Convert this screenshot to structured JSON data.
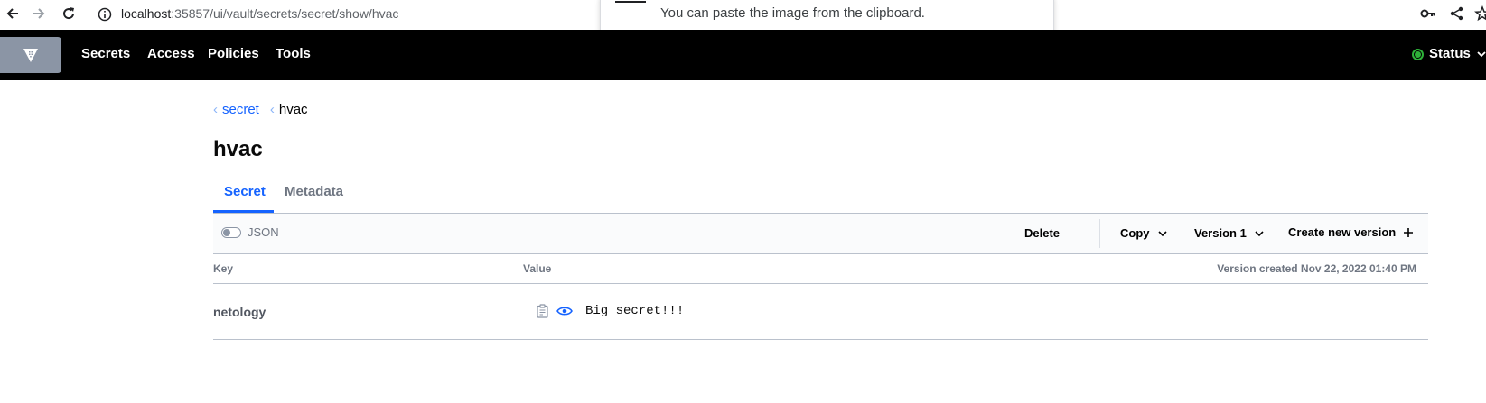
{
  "browser": {
    "url_host": "localhost",
    "url_rest": ":35857/ui/vault/secrets/secret/show/hvac"
  },
  "popup": {
    "message": "You can paste the image from the clipboard."
  },
  "nav": {
    "items": [
      {
        "label": "Secrets"
      },
      {
        "label": "Access"
      },
      {
        "label": "Policies"
      },
      {
        "label": "Tools"
      }
    ],
    "status_label": "Status",
    "status_color": "#2eb039"
  },
  "breadcrumb": {
    "parent": "secret",
    "current": "hvac"
  },
  "page": {
    "title": "hvac"
  },
  "tabs": [
    {
      "label": "Secret",
      "active": true
    },
    {
      "label": "Metadata",
      "active": false
    }
  ],
  "toolbar": {
    "json_toggle_label": "JSON",
    "delete_label": "Delete",
    "copy_label": "Copy",
    "version_label": "Version 1",
    "create_label": "Create new version"
  },
  "table": {
    "key_header": "Key",
    "value_header": "Value",
    "version_created": "Version created Nov 22, 2022 01:40 PM",
    "rows": [
      {
        "key": "netology",
        "value": "Big secret!!!"
      }
    ]
  },
  "colors": {
    "accent": "#1563ff",
    "nav_bg": "#000000",
    "logo_bg": "#8b95a5"
  }
}
